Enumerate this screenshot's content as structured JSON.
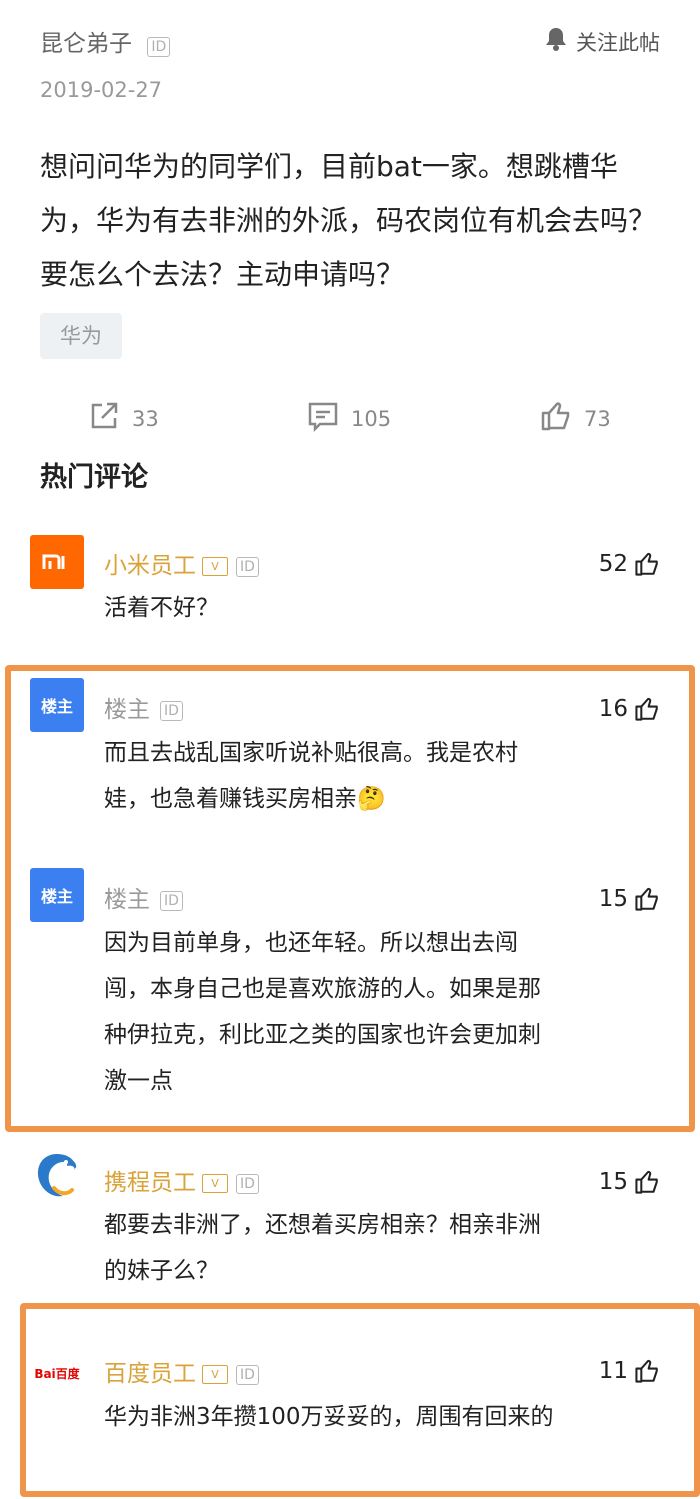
{
  "post": {
    "author": "昆仑弟子",
    "id_badge": "ID",
    "follow_label": "关注此帖",
    "date": "2019-02-27",
    "body": "想问问华为的同学们，目前bat一家。想跳槽华为，华为有去非洲的外派，码农岗位有机会去吗？要怎么个去法？主动申请吗？",
    "tag": "华为",
    "share_count": "33",
    "comment_count": "105",
    "like_count": "73"
  },
  "section_title": "热门评论",
  "comments": [
    {
      "author": "小米员工",
      "avatar_text": "mi",
      "text": "活着不好？",
      "likes": "52"
    },
    {
      "author": "楼主",
      "avatar_text": "楼主",
      "text": "而且去战乱国家听说补贴很高。我是农村娃，也急着赚钱买房相亲",
      "emoji": "🤔",
      "likes": "16"
    },
    {
      "author": "楼主",
      "avatar_text": "楼主",
      "text": "因为目前单身，也还年轻。所以想出去闯闯，本身自己也是喜欢旅游的人。如果是那种伊拉克，利比亚之类的国家也许会更加刺激一点",
      "likes": "15"
    },
    {
      "author": "携程员工",
      "text": "都要去非洲了，还想着买房相亲？相亲非洲的妹子么？",
      "likes": "15"
    },
    {
      "author": "百度员工",
      "avatar_text": "Bai百度",
      "text": "华为非洲3年攒100万妥妥的，周围有回来的",
      "likes": "11"
    }
  ],
  "v_badge": "V",
  "colors": {
    "orange_name": "#d9a33a",
    "highlight": "#f0944a",
    "xiaomi": "#ff6700",
    "op_avatar": "#3b7ff0"
  }
}
